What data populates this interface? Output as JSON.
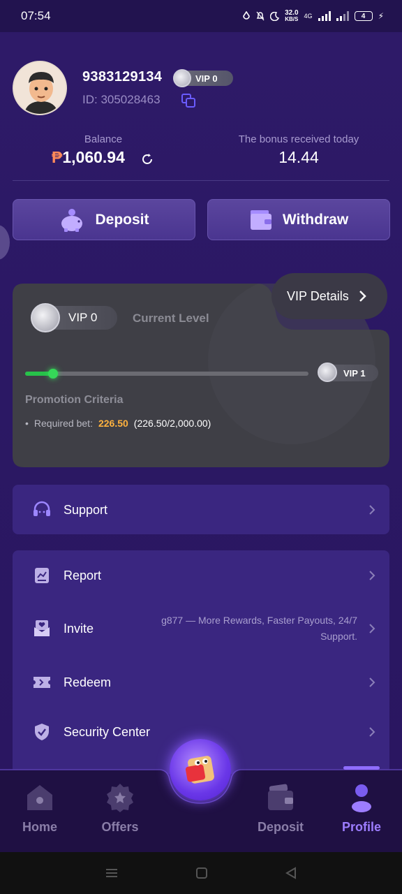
{
  "status_bar": {
    "time": "07:54",
    "net_speed_value": "32.0",
    "net_speed_unit": "KB/S",
    "network": "4G",
    "battery": "4"
  },
  "profile": {
    "username": "9383129134",
    "vip_level": "VIP 0",
    "user_id": "ID: 305028463"
  },
  "balance": {
    "label": "Balance",
    "currency": "₱",
    "value": "1,060.94"
  },
  "bonus": {
    "label": "The bonus received today",
    "value": "14.44"
  },
  "actions": {
    "deposit": "Deposit",
    "withdraw": "Withdraw"
  },
  "vip_card": {
    "details_label": "VIP Details",
    "current_vip": "VIP 0",
    "current_level_label": "Current Level",
    "next_vip": "VIP 1",
    "progress_fraction": 0.113,
    "promotion_title": "Promotion Criteria",
    "bullet": "•",
    "required_bet_label": "Required bet:",
    "required_bet_value": "226.50",
    "required_bet_ratio": "(226.50/2,000.00)"
  },
  "menu": {
    "support": "Support",
    "report": "Report",
    "invite": "Invite",
    "invite_note": "g877 — More Rewards, Faster Payouts, 24/7 Support.",
    "redeem": "Redeem",
    "security": "Security Center"
  },
  "nav": {
    "home": "Home",
    "offers": "Offers",
    "deposit": "Deposit",
    "profile": "Profile",
    "active": "profile"
  },
  "colors": {
    "accent": "#9d7dff",
    "progress": "#27c24a",
    "bet_value": "#ffb23e",
    "peso": "#ff8a5a"
  }
}
